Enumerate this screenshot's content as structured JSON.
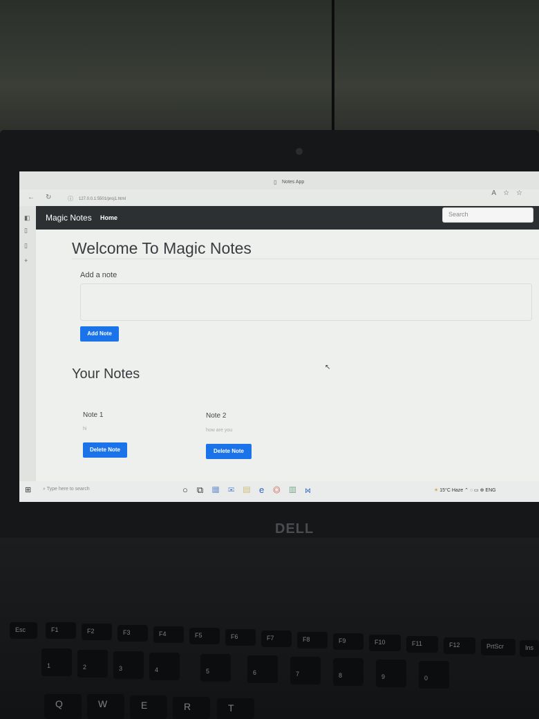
{
  "browser": {
    "tab_title": "Notes App",
    "url": "127.0.0.1:5501/proj1.html",
    "icons": [
      "refresh-icon",
      "info-icon",
      "read-aloud-icon",
      "favorite-icon",
      "collections-icon"
    ]
  },
  "navbar": {
    "brand": "Magic Notes",
    "home_label": "Home",
    "search_placeholder": "Search"
  },
  "main": {
    "heading": "Welcome To Magic Notes",
    "add_label": "Add a note",
    "add_button": "Add Note",
    "notes_heading": "Your Notes"
  },
  "notes": [
    {
      "title": "Note 1",
      "text": "hi",
      "delete_label": "Delete Note"
    },
    {
      "title": "Note 2",
      "text": "how are you",
      "delete_label": "Delete Note"
    }
  ],
  "taskbar": {
    "search_placeholder": "Type here to search",
    "weather": "15°C Haze",
    "language": "ENG"
  },
  "laptop": {
    "brand": "DELL"
  },
  "keyboard": {
    "function_row": [
      "Esc",
      "F1",
      "F2",
      "F3",
      "F4",
      "F5",
      "F6",
      "F7",
      "F8",
      "F9",
      "F10",
      "F11",
      "F12",
      "PrtScr",
      "Ins"
    ],
    "number_row": [
      "1",
      "2",
      "3",
      "4",
      "5",
      "6",
      "7",
      "8",
      "9",
      "0"
    ],
    "letter_row": [
      "Q",
      "W",
      "E",
      "R",
      "T"
    ]
  },
  "colors": {
    "primary": "#1a73e8",
    "navbar": "#2d3033"
  }
}
